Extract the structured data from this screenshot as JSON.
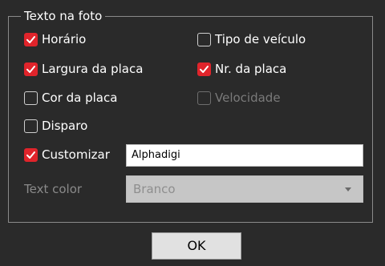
{
  "group_title": "Texto na foto",
  "checkboxes": {
    "horario": {
      "label": "Horário",
      "checked": true,
      "enabled": true
    },
    "tipo_veiculo": {
      "label": "Tipo de veículo",
      "checked": false,
      "enabled": true
    },
    "largura_placa": {
      "label": "Largura da placa",
      "checked": true,
      "enabled": true
    },
    "nr_placa": {
      "label": "Nr. da placa",
      "checked": true,
      "enabled": true
    },
    "cor_placa": {
      "label": "Cor da placa",
      "checked": false,
      "enabled": true
    },
    "velocidade": {
      "label": "Velocidade",
      "checked": false,
      "enabled": false
    },
    "disparo": {
      "label": "Disparo",
      "checked": false,
      "enabled": true
    },
    "customizar": {
      "label": "Customizar",
      "checked": true,
      "enabled": true
    }
  },
  "custom_text": {
    "value": "Alphadigi"
  },
  "text_color": {
    "label": "Text color",
    "selected": "Branco"
  },
  "ok_button": {
    "label": "OK"
  },
  "colors": {
    "background": "#2a2a2a",
    "check_red": "#e0242b",
    "frame": "#8a8a8a",
    "disabled_text": "#7a7a7a"
  }
}
